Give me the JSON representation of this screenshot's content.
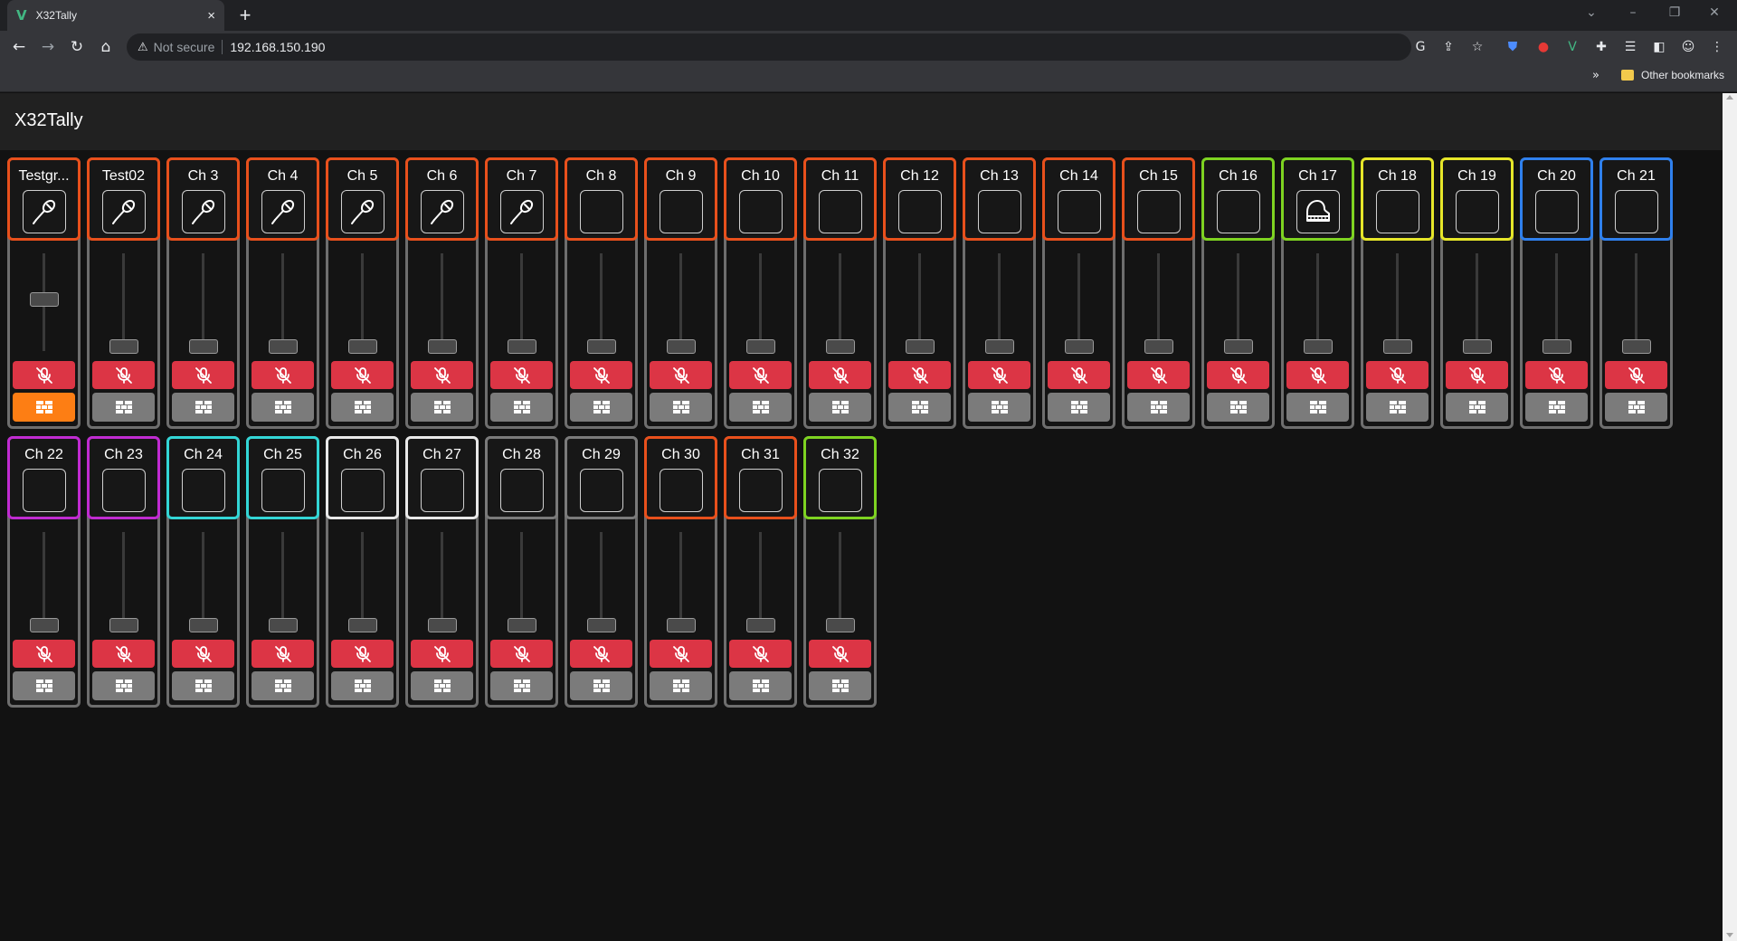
{
  "browser": {
    "tab_title": "X32Tally",
    "tab_close": "×",
    "new_tab": "+",
    "security_label": "Not secure",
    "url": "192.168.150.190",
    "bookmarks_more": "»",
    "other_bookmarks": "Other bookmarks"
  },
  "app": {
    "title": "X32Tally"
  },
  "colors": {
    "orange": "#e8501c",
    "green": "#7ed321",
    "yellow": "#e6e629",
    "blue": "#2f80ed",
    "magenta": "#c02bd1",
    "cyan": "#33d6d6",
    "white": "#e8e8e8",
    "gray": "#7a7a7a",
    "mute_red": "#dc3545",
    "solo_orange": "#fd7e14"
  },
  "channels": [
    {
      "name": "Testgr...",
      "color": "orange",
      "icon": "microphone-icon",
      "fader": 0.55,
      "solo": true
    },
    {
      "name": "Test02",
      "color": "orange",
      "icon": "microphone-icon",
      "fader": 0.0,
      "solo": false
    },
    {
      "name": "Ch 3",
      "color": "orange",
      "icon": "microphone-icon",
      "fader": 0.0,
      "solo": false
    },
    {
      "name": "Ch 4",
      "color": "orange",
      "icon": "microphone-icon",
      "fader": 0.0,
      "solo": false
    },
    {
      "name": "Ch 5",
      "color": "orange",
      "icon": "microphone-icon",
      "fader": 0.0,
      "solo": false
    },
    {
      "name": "Ch 6",
      "color": "orange",
      "icon": "microphone-icon",
      "fader": 0.0,
      "solo": false
    },
    {
      "name": "Ch 7",
      "color": "orange",
      "icon": "microphone-icon",
      "fader": 0.0,
      "solo": false
    },
    {
      "name": "Ch 8",
      "color": "orange",
      "icon": "",
      "fader": 0.0,
      "solo": false
    },
    {
      "name": "Ch 9",
      "color": "orange",
      "icon": "",
      "fader": 0.0,
      "solo": false
    },
    {
      "name": "Ch 10",
      "color": "orange",
      "icon": "",
      "fader": 0.0,
      "solo": false
    },
    {
      "name": "Ch 11",
      "color": "orange",
      "icon": "",
      "fader": 0.0,
      "solo": false
    },
    {
      "name": "Ch 12",
      "color": "orange",
      "icon": "",
      "fader": 0.0,
      "solo": false
    },
    {
      "name": "Ch 13",
      "color": "orange",
      "icon": "",
      "fader": 0.0,
      "solo": false
    },
    {
      "name": "Ch 14",
      "color": "orange",
      "icon": "",
      "fader": 0.0,
      "solo": false
    },
    {
      "name": "Ch 15",
      "color": "orange",
      "icon": "",
      "fader": 0.0,
      "solo": false
    },
    {
      "name": "Ch 16",
      "color": "green",
      "icon": "",
      "fader": 0.0,
      "solo": false
    },
    {
      "name": "Ch 17",
      "color": "green",
      "icon": "piano-icon",
      "fader": 0.0,
      "solo": false
    },
    {
      "name": "Ch 18",
      "color": "yellow",
      "icon": "",
      "fader": 0.0,
      "solo": false
    },
    {
      "name": "Ch 19",
      "color": "yellow",
      "icon": "",
      "fader": 0.0,
      "solo": false
    },
    {
      "name": "Ch 20",
      "color": "blue",
      "icon": "",
      "fader": 0.0,
      "solo": false
    },
    {
      "name": "Ch 21",
      "color": "blue",
      "icon": "",
      "fader": 0.0,
      "solo": false
    },
    {
      "name": "Ch 22",
      "color": "magenta",
      "icon": "",
      "fader": 0.0,
      "solo": false
    },
    {
      "name": "Ch 23",
      "color": "magenta",
      "icon": "",
      "fader": 0.0,
      "solo": false
    },
    {
      "name": "Ch 24",
      "color": "cyan",
      "icon": "",
      "fader": 0.0,
      "solo": false
    },
    {
      "name": "Ch 25",
      "color": "cyan",
      "icon": "",
      "fader": 0.0,
      "solo": false
    },
    {
      "name": "Ch 26",
      "color": "white",
      "icon": "",
      "fader": 0.0,
      "solo": false
    },
    {
      "name": "Ch 27",
      "color": "white",
      "icon": "",
      "fader": 0.0,
      "solo": false
    },
    {
      "name": "Ch 28",
      "color": "gray",
      "icon": "",
      "fader": 0.0,
      "solo": false
    },
    {
      "name": "Ch 29",
      "color": "gray",
      "icon": "",
      "fader": 0.0,
      "solo": false
    },
    {
      "name": "Ch 30",
      "color": "orange",
      "icon": "",
      "fader": 0.0,
      "solo": false
    },
    {
      "name": "Ch 31",
      "color": "orange",
      "icon": "",
      "fader": 0.0,
      "solo": false
    },
    {
      "name": "Ch 32",
      "color": "green",
      "icon": "",
      "fader": 0.0,
      "solo": false
    }
  ]
}
